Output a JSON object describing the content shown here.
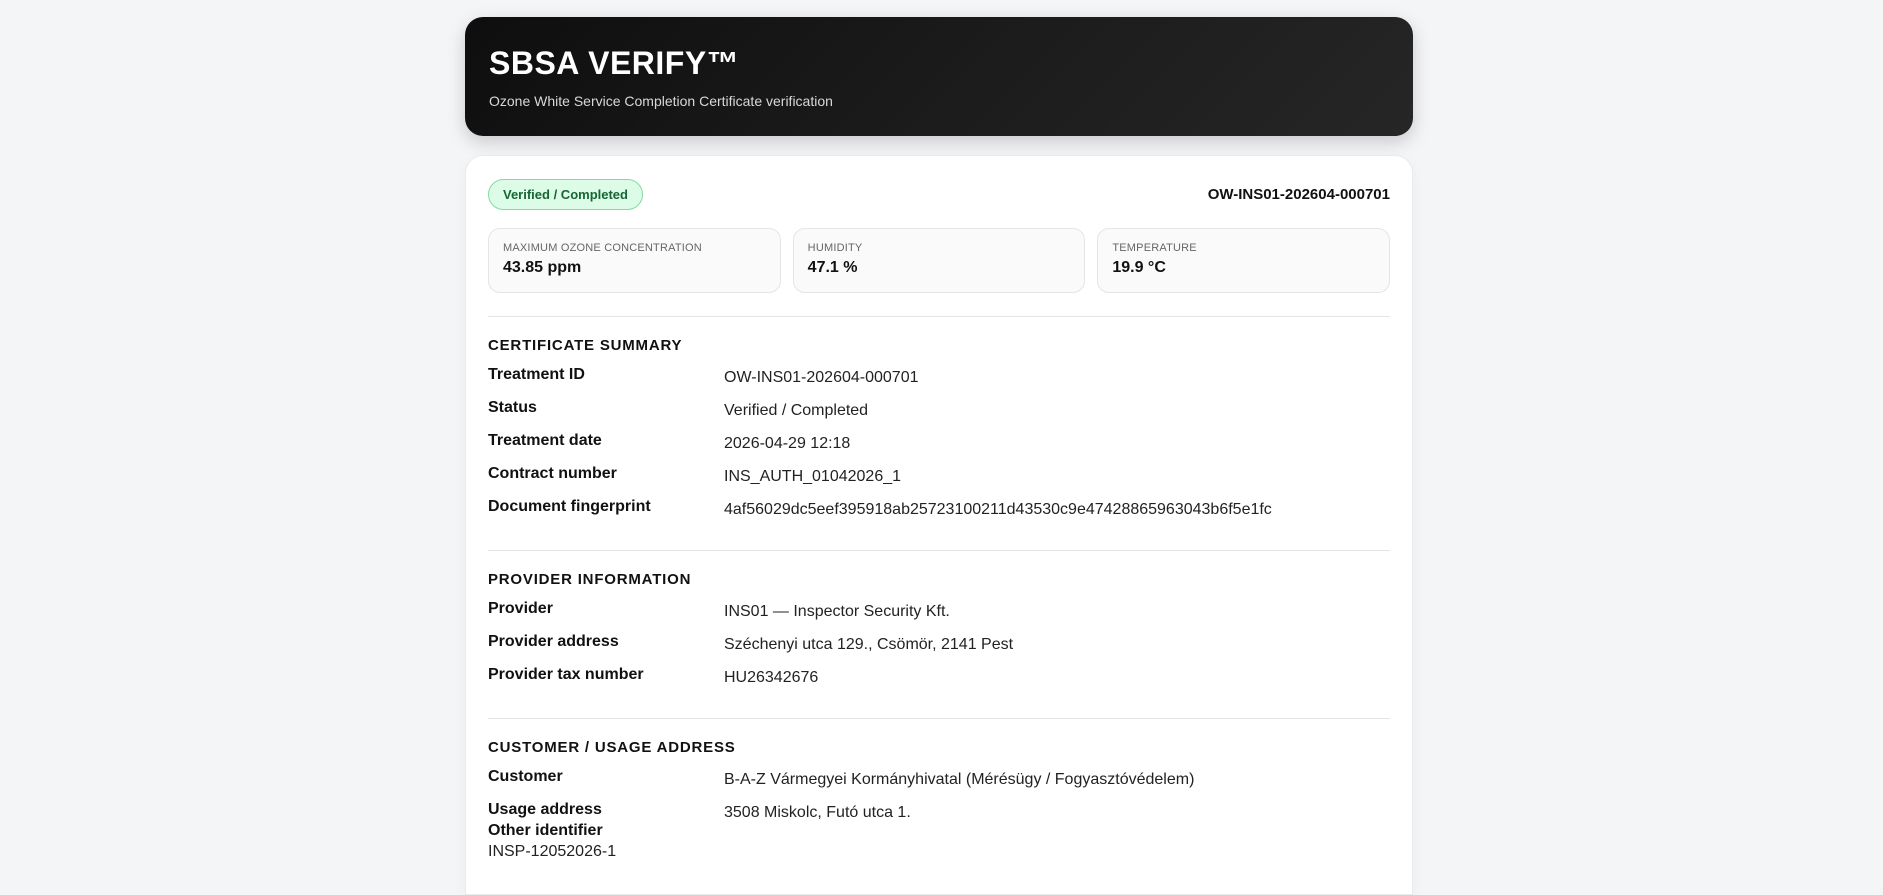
{
  "header": {
    "title": "SBSA VERIFY™",
    "subtitle": "Ozone White Service Completion Certificate verification"
  },
  "status_badge": "Verified / Completed",
  "certificate_code": "OW-INS01-202604-000701",
  "metrics": [
    {
      "label": "MAXIMUM OZONE CONCENTRATION",
      "value": "43.85 ppm"
    },
    {
      "label": "HUMIDITY",
      "value": "47.1 %"
    },
    {
      "label": "TEMPERATURE",
      "value": "19.9 °C"
    }
  ],
  "summary": {
    "title": "CERTIFICATE SUMMARY",
    "rows": [
      {
        "key": "Treatment ID",
        "value": "OW-INS01-202604-000701"
      },
      {
        "key": "Status",
        "value": "Verified / Completed"
      },
      {
        "key": "Treatment date",
        "value": "2026-04-29 12:18"
      },
      {
        "key": "Contract number",
        "value": "INS_AUTH_01042026_1"
      },
      {
        "key": "Document fingerprint",
        "value": "4af56029dc5eef395918ab25723100211d43530c9e47428865963043b6f5e1fc"
      }
    ]
  },
  "provider": {
    "title": "PROVIDER INFORMATION",
    "rows": [
      {
        "key": "Provider",
        "value": "INS01 — Inspector Security Kft."
      },
      {
        "key": "Provider address",
        "value": "Széchenyi utca 129., Csömör, 2141 Pest"
      },
      {
        "key": "Provider tax number",
        "value": "HU26342676"
      }
    ]
  },
  "customer": {
    "title": "CUSTOMER / USAGE ADDRESS",
    "rows": [
      {
        "key": "Customer",
        "value": "B-A-Z Vármegyei Kormányhivatal (Mérésügy / Fogyasztóvédelem)"
      },
      {
        "key": "Usage address",
        "value": "3508 Miskolc, Futó utca 1."
      }
    ],
    "other_identifier_label": "Other identifier",
    "other_identifier_value": "INSP-12052026-1"
  }
}
